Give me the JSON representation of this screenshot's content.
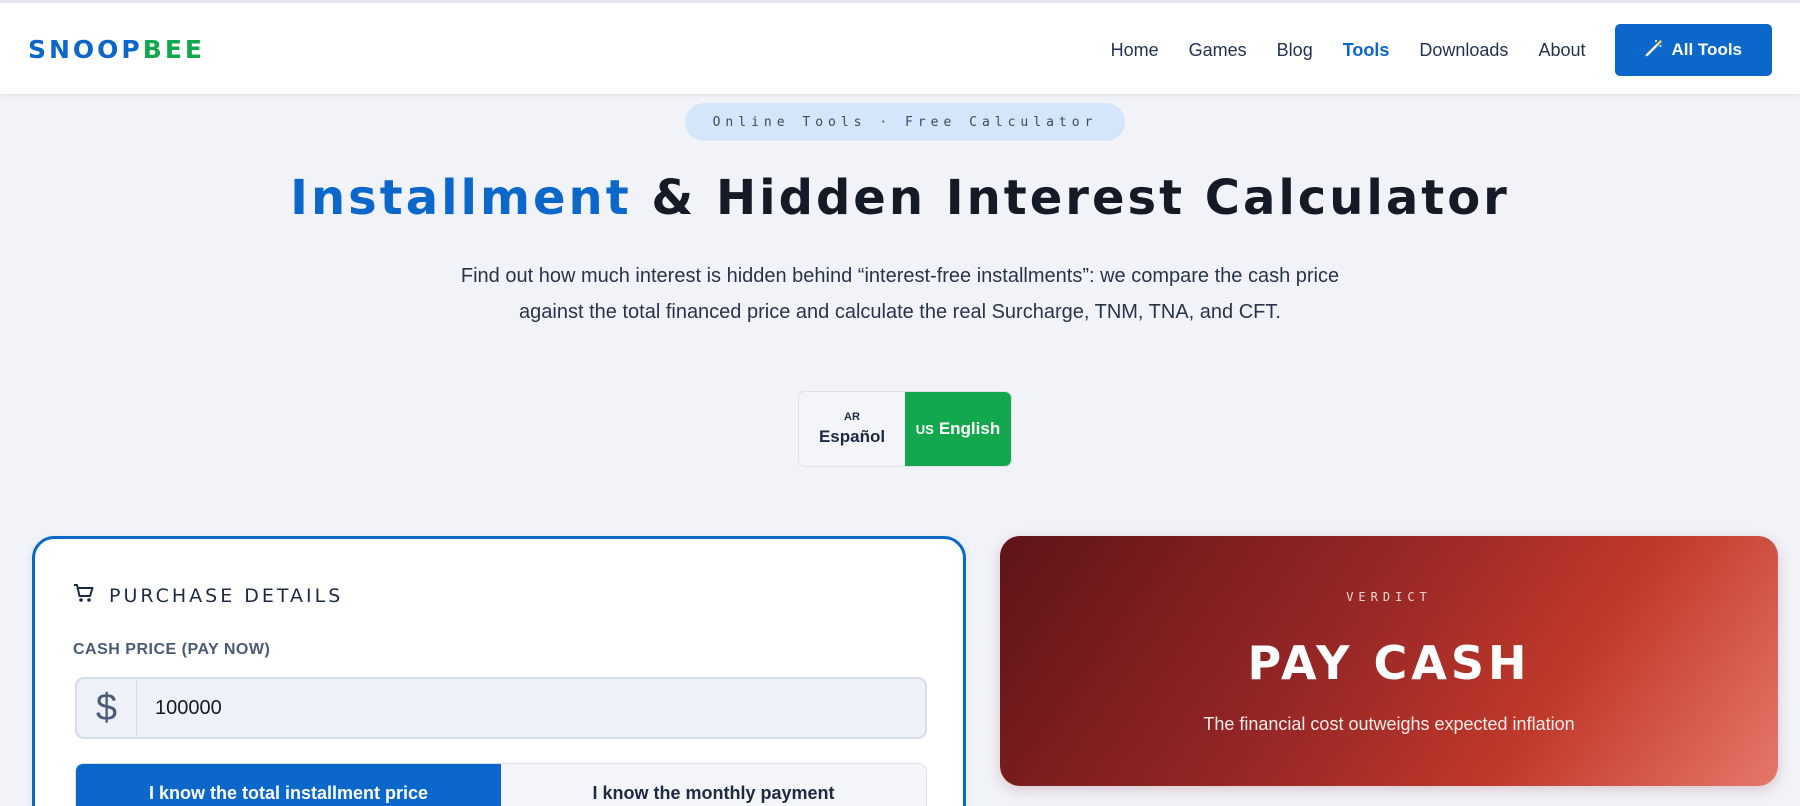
{
  "header": {
    "logo_part1": "SNOOP",
    "logo_part2": "BEE",
    "nav": [
      "Home",
      "Games",
      "Blog",
      "Tools",
      "Downloads",
      "About"
    ],
    "active_nav": "Tools",
    "all_tools_label": "All Tools",
    "all_tools_icon": "magic-wand-icon"
  },
  "hero": {
    "pill": "Online Tools · Free Calculator",
    "title_highlight": "Installment",
    "title_rest": " & Hidden Interest Calculator",
    "subtitle": "Find out how much interest is hidden behind “interest-free installments”: we compare the cash price against the total financed price and calculate the real Surcharge, TNM, TNA, and CFT."
  },
  "language": {
    "es_code": "AR",
    "es_label": "Español",
    "en_code": "US",
    "en_label": "English",
    "selected": "English"
  },
  "purchase": {
    "section_title": "PURCHASE DETAILS",
    "section_icon": "shopping-cart-icon",
    "cash_label": "CASH PRICE (PAY NOW)",
    "currency_symbol": "$",
    "cash_value": "100000",
    "mode_total": "I know the total installment price",
    "mode_monthly": "I know the monthly payment",
    "selected_mode": "I know the total installment price"
  },
  "verdict": {
    "label": "VERDICT",
    "result": "PAY CASH",
    "reason": "The financial cost outweighs expected inflation"
  },
  "colors": {
    "primary": "#0b67c9",
    "green": "#13a84d",
    "verdict_dark": "#5e1418",
    "verdict_light": "#e6786a"
  }
}
